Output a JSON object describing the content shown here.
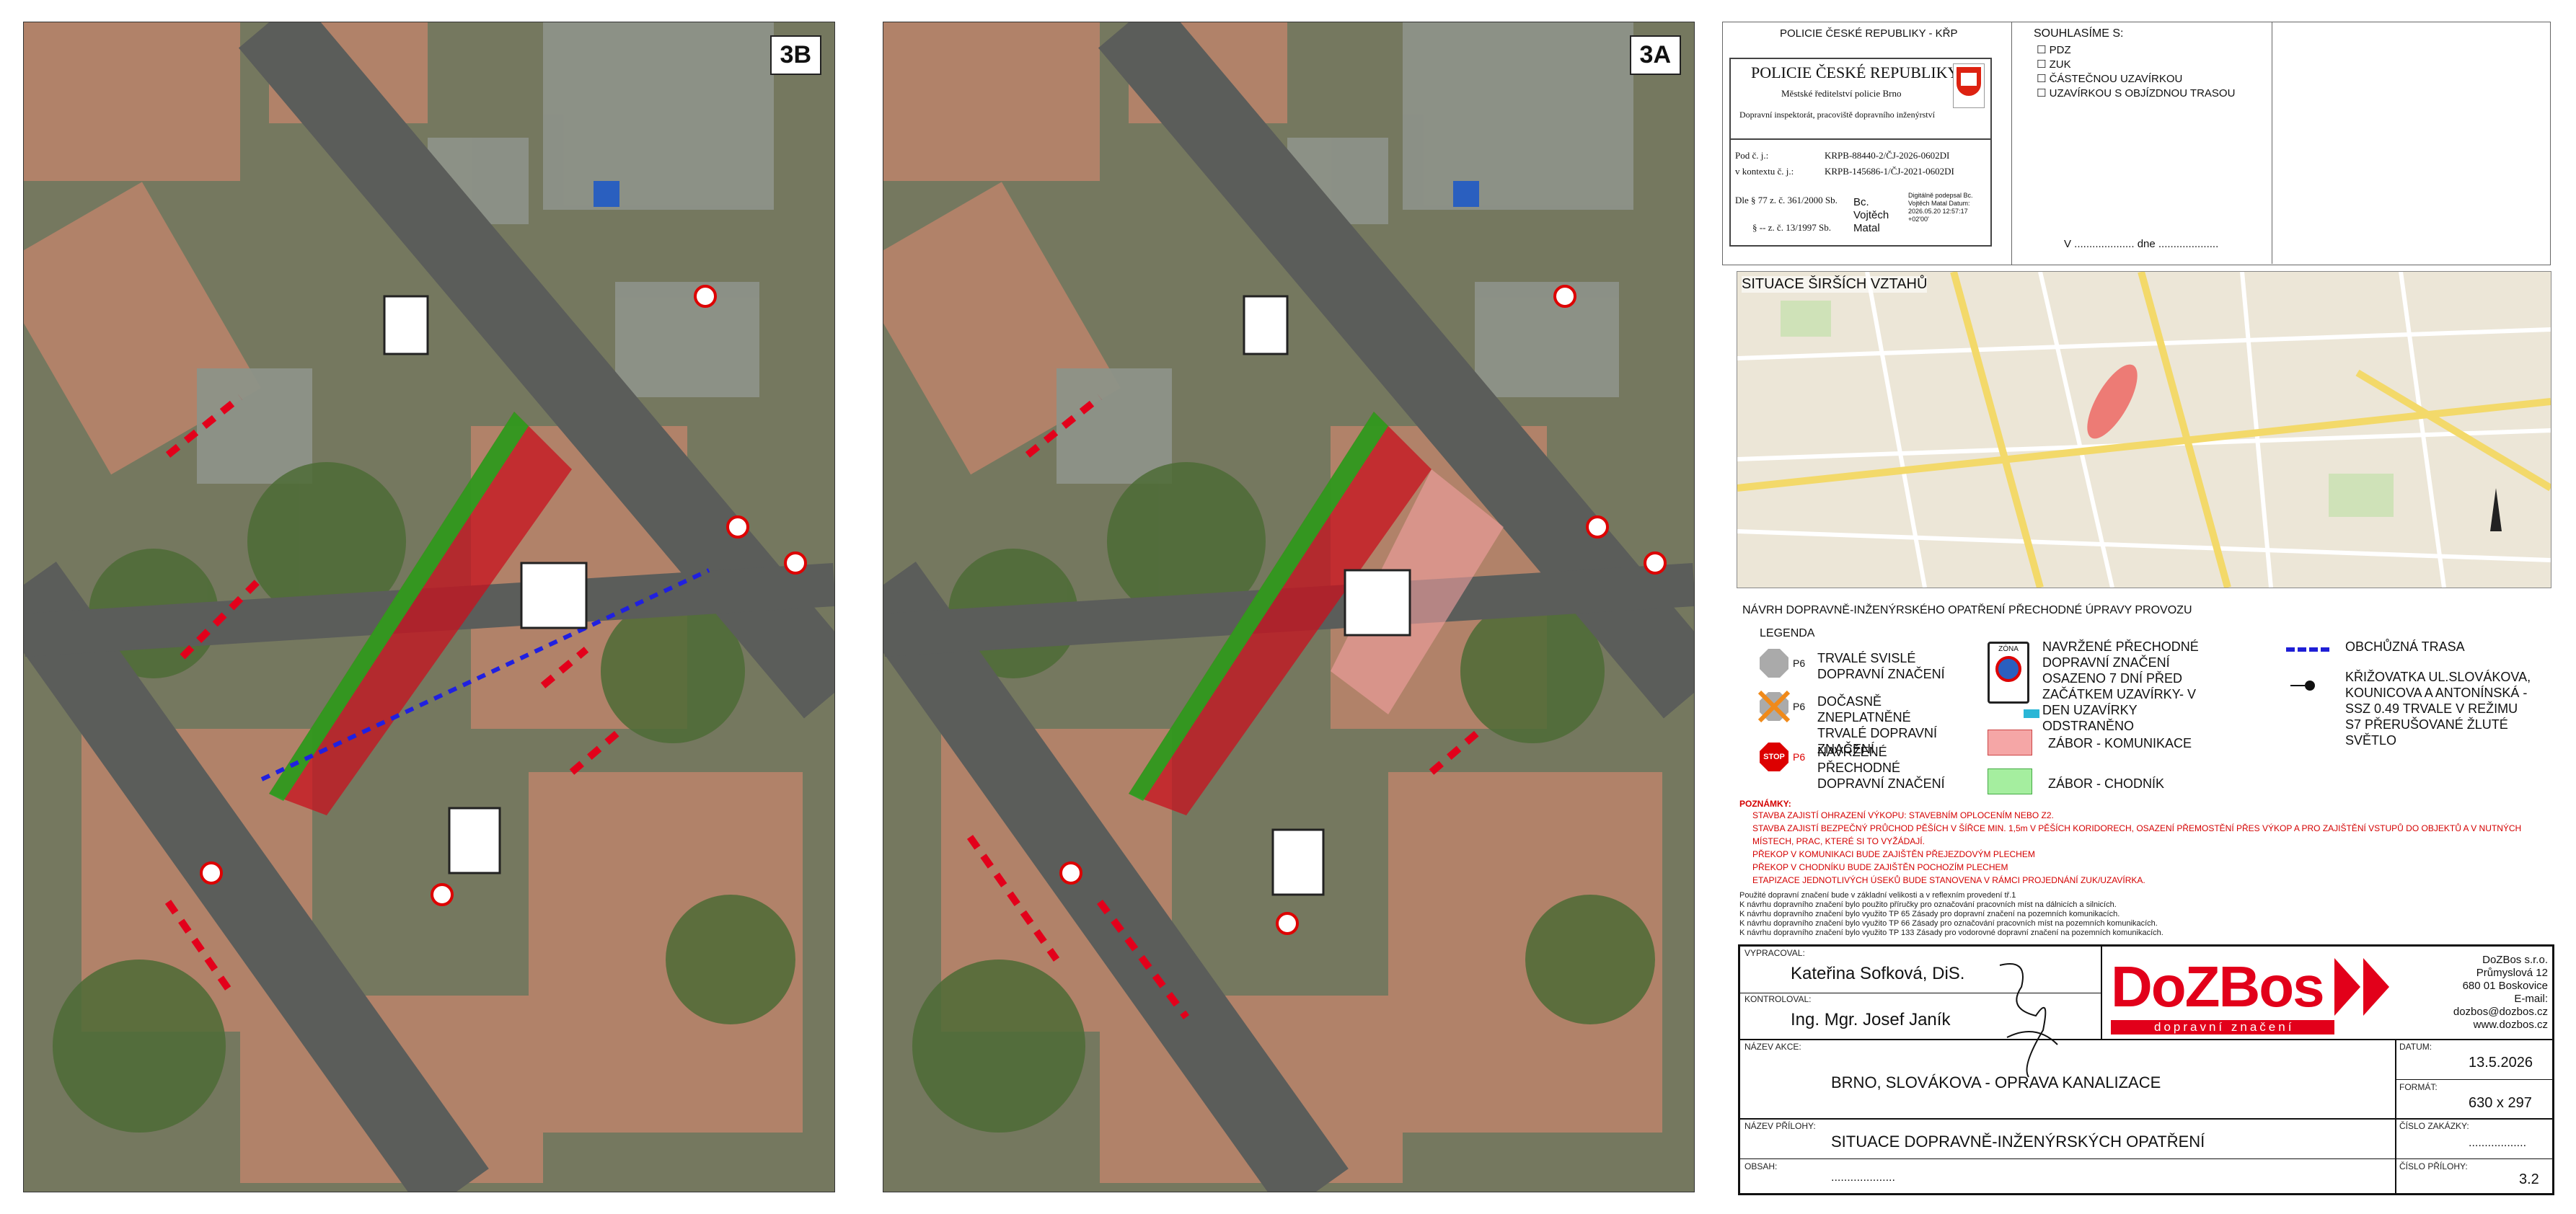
{
  "maps": [
    {
      "label": "3B"
    },
    {
      "label": "3A"
    }
  ],
  "police_header": {
    "top_title": "POLICIE ČESKÉ REPUBLIKY - KŘP",
    "stamp_title": "POLICIE ČESKÉ REPUBLIKY",
    "stamp_line1": "Městské ředitelství policie Brno",
    "stamp_line2": "Dopravní inspektorát, pracoviště dopravního inženýrství",
    "ref_label1": "Pod č. j.:",
    "ref_value1": "KRPB-88440-2/ČJ-2026-0602DI",
    "ref_label2": "v kontextu č. j.:",
    "ref_value2": "KRPB-145686-1/ČJ-2021-0602DI",
    "law1": "Dle § 77 z. č. 361/2000 Sb.",
    "law2": "§ -- z. č. 13/1997 Sb.",
    "signer": "Bc. Vojtěch Matal",
    "digital_sig": "Digitálně podepsal Bc. Vojtěch Matal Datum: 2026.05.20 12:57:17 +02'00'"
  },
  "agreement": {
    "title": "SOUHLASÍME S:",
    "options": [
      "PDZ",
      "ZUK",
      "ČÁSTEČNOU UZAVÍRKOU",
      "UZAVÍRKOU S OBJÍZDNOU TRASOU"
    ],
    "date_line": "V .................... dne ...................."
  },
  "context_map": {
    "title": "SITUACE ŠIRŠÍCH VZTAHŮ"
  },
  "legend": {
    "heading": "NÁVRH DOPRAVNĚ-INŽENÝRSKÉHO OPATŘENÍ PŘECHODNÉ ÚPRAVY PROVOZU",
    "title": "LEGENDA",
    "items": [
      {
        "code": "P6",
        "text": "TRVALÉ SVISLÉ DOPRAVNÍ ZNAČENÍ"
      },
      {
        "code": "P6",
        "text": "DOČASNĚ ZNEPLATNĚNÉ TRVALÉ DOPRAVNÍ ZNAČENÍ"
      },
      {
        "code": "P6",
        "text": "NAVRŽENÉ PŘECHODNÉ DOPRAVNÍ ZNAČENÍ"
      },
      {
        "code": "",
        "text": "NAVRŽENÉ PŘECHODNÉ DOPRAVNÍ ZNAČENÍ OSAZENO 7 DNÍ PŘED ZAČÁTKEM UZAVÍRKY- V DEN UZAVÍRKY ODSTRANĚNO"
      },
      {
        "code": "",
        "text": "ZÁBOR - KOMUNIKACE"
      },
      {
        "code": "",
        "text": "ZÁBOR - CHODNÍK"
      },
      {
        "code": "",
        "text": "OBCHŮZNÁ TRASA"
      },
      {
        "code": "",
        "text": "KŘIŽOVATKA UL.SLOVÁKOVA, KOUNICOVA A ANTONÍNSKÁ - SSZ 0.49 TRVALE V REŽIMU S7 PŘERUŠOVANÉ ŽLUTÉ SVĚTLO"
      }
    ],
    "zone_sign_text": "ZÓNA"
  },
  "notes": {
    "title": "POZNÁMKY:",
    "lines": [
      "STAVBA ZAJISTÍ OHRAZENÍ VÝKOPU: STAVEBNÍM OPLOCENÍM NEBO Z2.",
      "STAVBA ZAJISTÍ BEZPEČNÝ PRŮCHOD PĚŠÍCH V ŠÍŘCE MIN. 1,5m V PĚŠÍCH KORIDORECH, OSAZENÍ PŘEMOSTĚNÍ PŘES VÝKOP A PRO ZAJIŠTĚNÍ VSTUPŮ DO OBJEKTŮ A V NUTNÝCH",
      "MÍSTECH, PRAC, KTERÉ SI TO VYŽÁDAJÍ.",
      "PŘEKOP V KOMUNIKACI BUDE ZAJIŠTĚN PŘEJEZDOVÝM PLECHEM",
      "PŘEKOP V CHODNÍKU BUDE ZAJIŠTĚN POCHOZÍM PLECHEM",
      "ETAPIZACE JEDNOTLIVÝCH ÚSEKŮ BUDE STANOVENA V RÁMCI PROJEDNÁNÍ ZUK/UZAVÍRKA."
    ],
    "fine": [
      "Použité dopravní značení bude v základní velikosti a v reflexním provedení tř.1",
      "K návrhu dopravního značení bylo použito příručky pro označování pracovních míst na dálnicích a silnicích.",
      "K návrhu dopravního značení bylo využito TP 65 Zásady pro dopravní značení na pozemních komunikacích.",
      "K návrhu dopravního značení bylo využito TP 66 Zásady pro označování pracovních míst na pozemních komunikacích.",
      "K návrhu dopravního značení bylo využito TP 133 Zásady pro vodorovné dopravní značení na pozemních komunikacích."
    ]
  },
  "title_block": {
    "prepared_label": "VYPRACOVAL:",
    "prepared_by": "Kateřina Sofková, DiS.",
    "checked_label": "KONTROLOVAL:",
    "checked_by": "Ing. Mgr. Josef Janík",
    "logo": "DoZBos",
    "logo_sub": "dopravní značení",
    "company_name": "DoZBos s.r.o.",
    "company_street": "Průmyslová 12",
    "company_city": "680 01 Boskovice",
    "company_email": "E-mail: dozbos@dozbos.cz",
    "company_web": "www.dozbos.cz",
    "action_label": "NÁZEV AKCE:",
    "action": "BRNO, SLOVÁKOVA - OPRAVA KANALIZACE",
    "attachment_label": "NÁZEV PŘÍLOHY:",
    "attachment": "SITUACE DOPRAVNĚ-INŽENÝRSKÝCH OPATŘENÍ",
    "content_label": "OBSAH:",
    "content": "....................",
    "date_label": "DATUM:",
    "date": "13.5.2026",
    "format_label": "FORMÁT:",
    "format": "630 x 297",
    "order_label": "ČÍSLO ZAKÁZKY:",
    "order": "..................",
    "attachment_no_label": "ČÍSLO PŘÍLOHY:",
    "attachment_no": "3.2"
  },
  "colors": {
    "closure_road": "#c8101e",
    "closure_walk": "#1faa1f",
    "detour": "#1f1fd6",
    "brand_red": "#e2001a"
  }
}
